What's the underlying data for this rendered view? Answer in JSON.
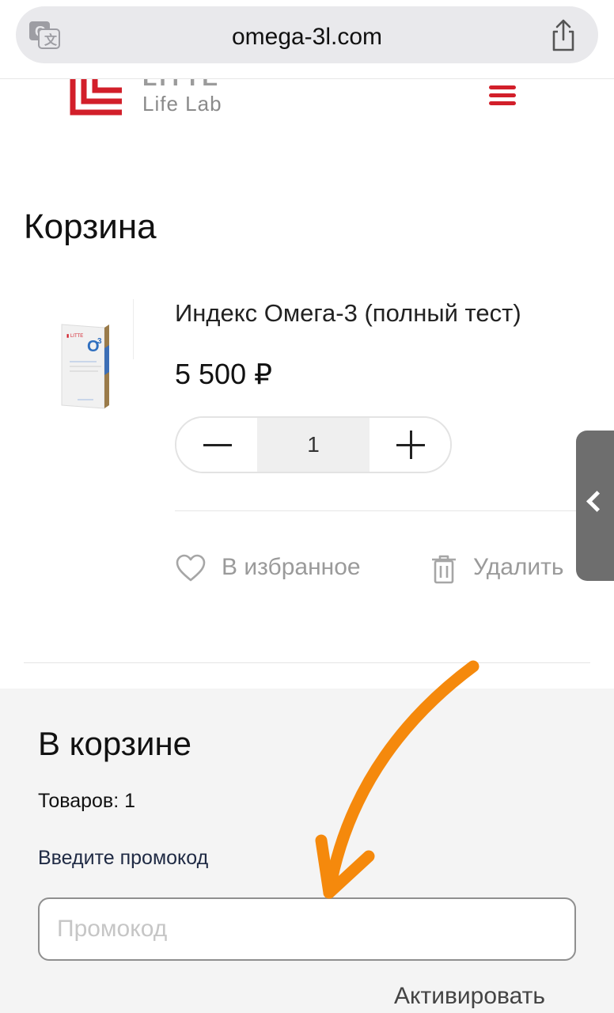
{
  "browser": {
    "url": "omega-3l.com"
  },
  "header": {
    "logo_name": "LITTE",
    "logo_sub": "Life Lab"
  },
  "cart": {
    "title": "Корзина",
    "item": {
      "name": "Индекс Омега-3 (полный тест)",
      "price": "5 500 ₽",
      "quantity": "1",
      "favorite_label": "В избранное",
      "delete_label": "Удалить"
    }
  },
  "summary": {
    "title": "В корзине",
    "items_count": "Товаров: 1",
    "promo_label": "Введите промокод",
    "promo_placeholder": "Промокод",
    "promo_value": "",
    "activate_label": "Активировать"
  },
  "colors": {
    "brand_red": "#d21f2a",
    "annotation_orange": "#f5890c"
  }
}
